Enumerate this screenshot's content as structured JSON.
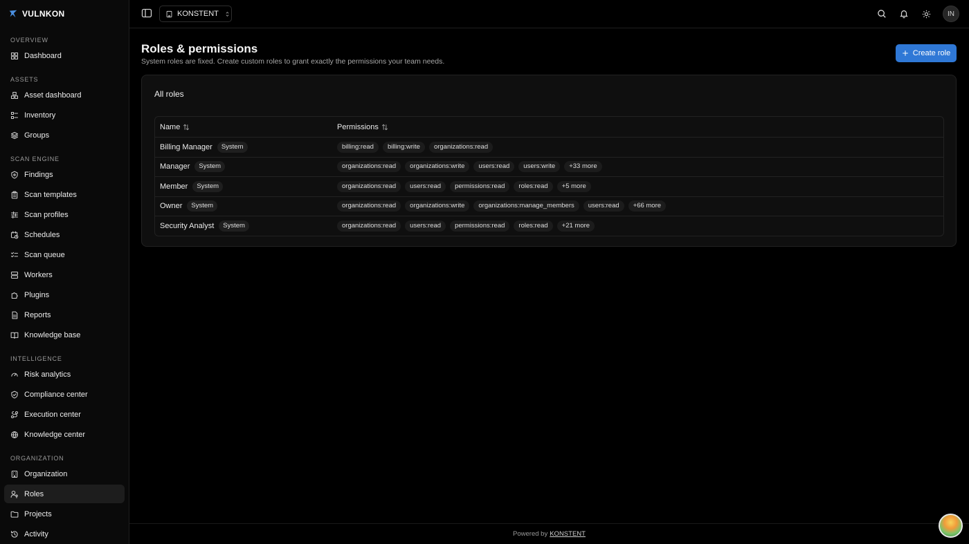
{
  "brand": {
    "name": "VULNKON",
    "icon": "brand-star-icon"
  },
  "sidebar": {
    "sections": [
      {
        "label": "OVERVIEW",
        "items": [
          {
            "label": "Dashboard",
            "icon": "grid-icon"
          }
        ]
      },
      {
        "label": "ASSETS",
        "items": [
          {
            "label": "Asset dashboard",
            "icon": "boxes-icon"
          },
          {
            "label": "Inventory",
            "icon": "list-icon"
          },
          {
            "label": "Groups",
            "icon": "layers-icon"
          }
        ]
      },
      {
        "label": "SCAN ENGINE",
        "items": [
          {
            "label": "Findings",
            "icon": "shield-icon"
          },
          {
            "label": "Scan templates",
            "icon": "clipboard-icon"
          },
          {
            "label": "Scan profiles",
            "icon": "sliders-icon"
          },
          {
            "label": "Schedules",
            "icon": "calendar-clock-icon"
          },
          {
            "label": "Scan queue",
            "icon": "list-checks-icon"
          },
          {
            "label": "Workers",
            "icon": "server-icon"
          },
          {
            "label": "Plugins",
            "icon": "puzzle-icon"
          },
          {
            "label": "Reports",
            "icon": "file-text-icon"
          },
          {
            "label": "Knowledge base",
            "icon": "book-open-icon"
          }
        ]
      },
      {
        "label": "INTELLIGENCE",
        "items": [
          {
            "label": "Risk analytics",
            "icon": "gauge-icon"
          },
          {
            "label": "Compliance center",
            "icon": "shield-check-icon"
          },
          {
            "label": "Execution center",
            "icon": "route-icon"
          },
          {
            "label": "Knowledge center",
            "icon": "globe-icon"
          }
        ]
      },
      {
        "label": "ORGANIZATION",
        "items": [
          {
            "label": "Organization",
            "icon": "building-icon"
          },
          {
            "label": "Roles",
            "icon": "user-key-icon",
            "active": true
          },
          {
            "label": "Projects",
            "icon": "folder-icon"
          },
          {
            "label": "Activity",
            "icon": "history-icon"
          }
        ]
      }
    ]
  },
  "topbar": {
    "org": "KONSTENT",
    "avatar_initials": "IN"
  },
  "page": {
    "title": "Roles & permissions",
    "subtitle": "System roles are fixed. Create custom roles to grant exactly the permissions your team needs.",
    "create_button": "Create role"
  },
  "card": {
    "title": "All roles",
    "columns": {
      "name": "Name",
      "permissions": "Permissions"
    },
    "rows": [
      {
        "name": "Billing Manager",
        "badge": "System",
        "perms": [
          "billing:read",
          "billing:write",
          "organizations:read"
        ]
      },
      {
        "name": "Manager",
        "badge": "System",
        "perms": [
          "organizations:read",
          "organizations:write",
          "users:read",
          "users:write",
          "+33 more"
        ]
      },
      {
        "name": "Member",
        "badge": "System",
        "perms": [
          "organizations:read",
          "users:read",
          "permissions:read",
          "roles:read",
          "+5 more"
        ]
      },
      {
        "name": "Owner",
        "badge": "System",
        "perms": [
          "organizations:read",
          "organizations:write",
          "organizations:manage_members",
          "users:read",
          "+66 more"
        ]
      },
      {
        "name": "Security Analyst",
        "badge": "System",
        "perms": [
          "organizations:read",
          "users:read",
          "permissions:read",
          "roles:read",
          "+21 more"
        ]
      }
    ]
  },
  "footer": {
    "prefix": "Powered by",
    "link": "KONSTENT"
  },
  "colors": {
    "accent": "#2f78d6",
    "background": "#000000",
    "sidebar": "#0a0a0a"
  }
}
